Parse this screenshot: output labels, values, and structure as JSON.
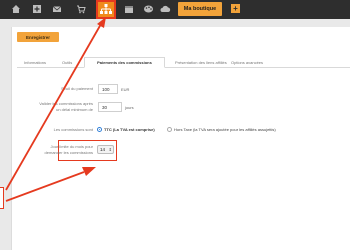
{
  "toolbar": {
    "icons": [
      "home-icon",
      "plus-icon",
      "mail-icon",
      "cart-icon",
      "sitemap-icon",
      "calendar-icon",
      "palette-icon",
      "cloud-icon",
      "plus-icon"
    ],
    "shop_button": "Ma boutique",
    "add_button": "+",
    "active_color": "#f08a1c",
    "accent_color": "#f2a33a"
  },
  "actions": {
    "save": "Enregistrer"
  },
  "tabs": [
    {
      "label": "Informations"
    },
    {
      "label": "Outils"
    },
    {
      "label": "Paiements des commissions",
      "active": true
    },
    {
      "label": "Présentation des liens affiliés"
    },
    {
      "label": "Options avancées"
    }
  ],
  "form": {
    "threshold": {
      "label": "Seuil du paiement",
      "value": "100",
      "unit": "EUR"
    },
    "delay": {
      "label_line1": "Valider les commissions après",
      "label_line2": "un délai minimum de",
      "value": "30",
      "unit": "jours"
    },
    "commissions": {
      "label": "Les commissions sont",
      "option_ttc": "TTC (La TVA est comprise)",
      "option_ht": "Hors Taxe (la TVA sera ajoutée pour les affiliés assujettis)"
    },
    "day_limit": {
      "label_line1": "Jour limite du mois pour",
      "label_line2": "demander les commissions",
      "value": "14"
    }
  },
  "annotation_color": "#e53a1f"
}
